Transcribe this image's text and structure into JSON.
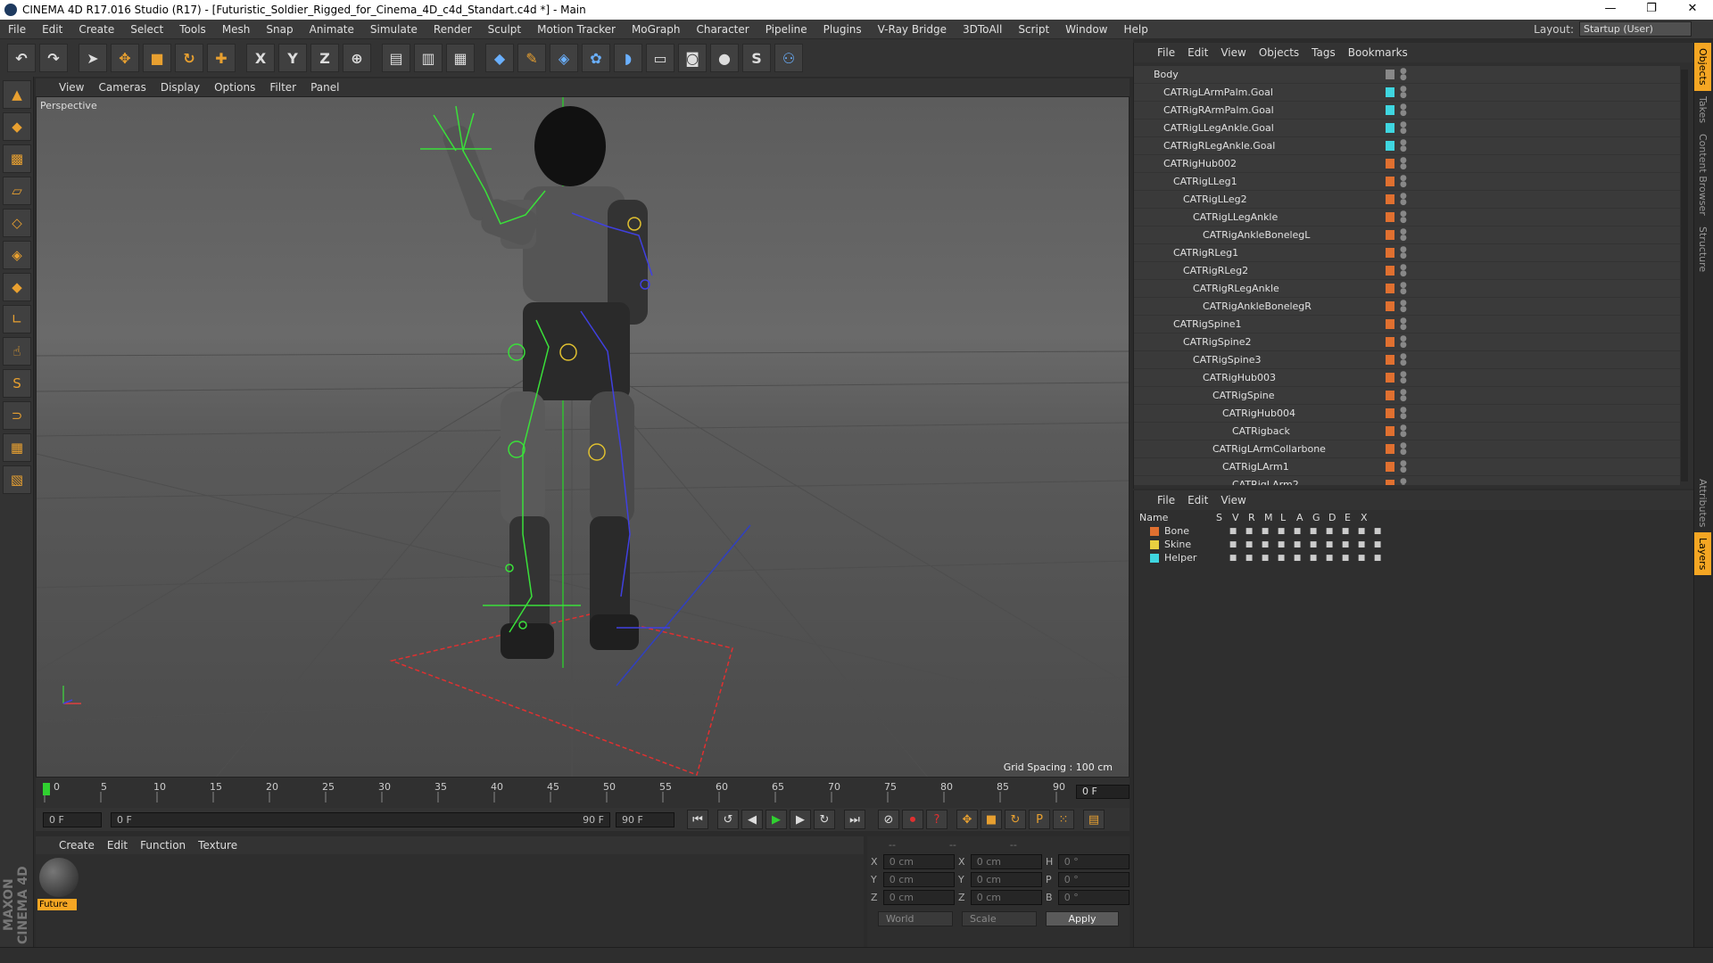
{
  "window": {
    "title": "CINEMA 4D R17.016 Studio (R17) - [Futuristic_Soldier_Rigged_for_Cinema_4D_c4d_Standart.c4d *] - Main"
  },
  "menubar": {
    "items": [
      "File",
      "Edit",
      "Create",
      "Select",
      "Tools",
      "Mesh",
      "Snap",
      "Animate",
      "Simulate",
      "Render",
      "Sculpt",
      "Motion Tracker",
      "MoGraph",
      "Character",
      "Pipeline",
      "Plugins",
      "V-Ray Bridge",
      "3DToAll",
      "Script",
      "Window",
      "Help"
    ],
    "layout_label": "Layout:",
    "layout_value": "Startup (User)"
  },
  "viewport": {
    "menu": [
      "View",
      "Cameras",
      "Display",
      "Options",
      "Filter",
      "Panel"
    ],
    "label": "Perspective",
    "grid_spacing": "Grid Spacing : 100 cm"
  },
  "timeline": {
    "ticks": [
      "0",
      "5",
      "10",
      "15",
      "20",
      "25",
      "30",
      "35",
      "40",
      "45",
      "50",
      "55",
      "60",
      "65",
      "70",
      "75",
      "80",
      "85",
      "90"
    ],
    "current_frame": "0 F",
    "start_field": "0 F",
    "range_start": "0 F",
    "range_end": "90 F",
    "end_field": "90 F"
  },
  "material_manager": {
    "menu": [
      "Create",
      "Edit",
      "Function",
      "Texture"
    ],
    "material_name": "Future"
  },
  "coordinates": {
    "headers": [
      "--",
      "--",
      "--"
    ],
    "rows": [
      {
        "a": "X",
        "av": "0 cm",
        "b": "X",
        "bv": "0 cm",
        "c": "H",
        "cv": "0 °"
      },
      {
        "a": "Y",
        "av": "0 cm",
        "b": "Y",
        "bv": "0 cm",
        "c": "P",
        "cv": "0 °"
      },
      {
        "a": "Z",
        "av": "0 cm",
        "b": "Z",
        "bv": "0 cm",
        "c": "B",
        "cv": "0 °"
      }
    ],
    "world": "World",
    "scale": "Scale",
    "apply": "Apply"
  },
  "object_manager": {
    "menu": [
      "File",
      "Edit",
      "View",
      "Objects",
      "Tags",
      "Bookmarks"
    ],
    "objects": [
      {
        "name": "Body",
        "indent": 0,
        "color": "#888888"
      },
      {
        "name": "CATRigLArmPalm.Goal",
        "indent": 1,
        "color": "#3fd6e0"
      },
      {
        "name": "CATRigRArmPalm.Goal",
        "indent": 1,
        "color": "#3fd6e0"
      },
      {
        "name": "CATRigLLegAnkle.Goal",
        "indent": 1,
        "color": "#3fd6e0"
      },
      {
        "name": "CATRigRLegAnkle.Goal",
        "indent": 1,
        "color": "#3fd6e0"
      },
      {
        "name": "CATRigHub002",
        "indent": 1,
        "color": "#e07030"
      },
      {
        "name": "CATRigLLeg1",
        "indent": 2,
        "color": "#e07030"
      },
      {
        "name": "CATRigLLeg2",
        "indent": 3,
        "color": "#e07030"
      },
      {
        "name": "CATRigLLegAnkle",
        "indent": 4,
        "color": "#e07030"
      },
      {
        "name": "CATRigAnkleBonelegL",
        "indent": 5,
        "color": "#e07030"
      },
      {
        "name": "CATRigRLeg1",
        "indent": 2,
        "color": "#e07030"
      },
      {
        "name": "CATRigRLeg2",
        "indent": 3,
        "color": "#e07030"
      },
      {
        "name": "CATRigRLegAnkle",
        "indent": 4,
        "color": "#e07030"
      },
      {
        "name": "CATRigAnkleBonelegR",
        "indent": 5,
        "color": "#e07030"
      },
      {
        "name": "CATRigSpine1",
        "indent": 2,
        "color": "#e07030"
      },
      {
        "name": "CATRigSpine2",
        "indent": 3,
        "color": "#e07030"
      },
      {
        "name": "CATRigSpine3",
        "indent": 4,
        "color": "#e07030"
      },
      {
        "name": "CATRigHub003",
        "indent": 5,
        "color": "#e07030"
      },
      {
        "name": "CATRigSpine",
        "indent": 6,
        "color": "#e07030"
      },
      {
        "name": "CATRigHub004",
        "indent": 7,
        "color": "#e07030"
      },
      {
        "name": "CATRigback",
        "indent": 8,
        "color": "#e07030"
      },
      {
        "name": "CATRigLArmCollarbone",
        "indent": 6,
        "color": "#e07030"
      },
      {
        "name": "CATRigLArm1",
        "indent": 7,
        "color": "#e07030"
      },
      {
        "name": "CATRigLArm2",
        "indent": 8,
        "color": "#e07030"
      }
    ]
  },
  "layer_manager": {
    "menu": [
      "File",
      "Edit",
      "View"
    ],
    "headers": [
      "Name",
      "S",
      "V",
      "R",
      "M",
      "L",
      "A",
      "G",
      "D",
      "E",
      "X"
    ],
    "layers": [
      {
        "name": "Bone",
        "color": "#e07030"
      },
      {
        "name": "Skine",
        "color": "#e8d040"
      },
      {
        "name": "Helper",
        "color": "#3fd6e0"
      }
    ]
  },
  "side_tabs": [
    "Objects",
    "Takes",
    "Content Browser",
    "Structure",
    "Attributes",
    "Layers"
  ],
  "brand": "MAXON CINEMA 4D"
}
